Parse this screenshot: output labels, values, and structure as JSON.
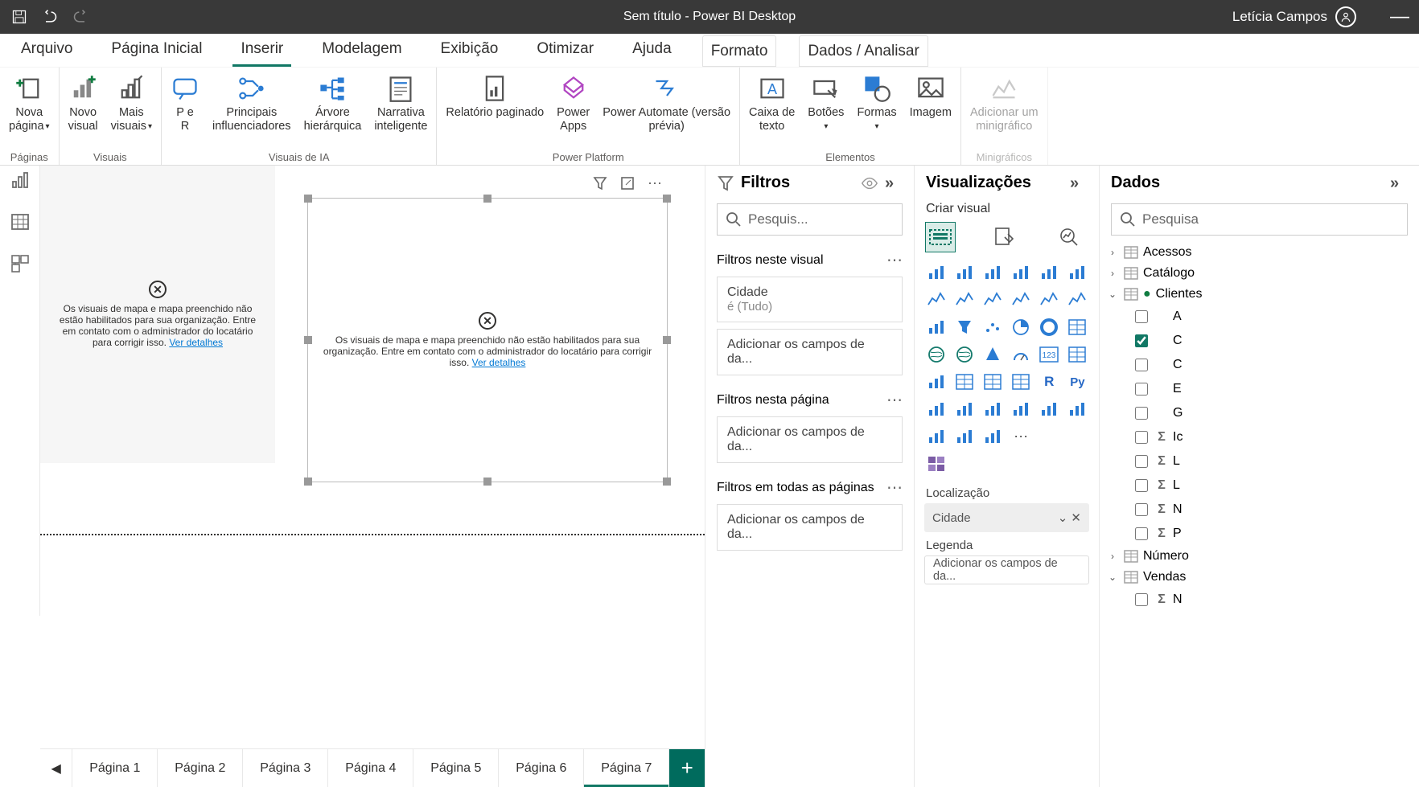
{
  "titlebar": {
    "title": "Sem título - Power BI Desktop",
    "user": "Letícia Campos"
  },
  "tabs": [
    "Arquivo",
    "Página Inicial",
    "Inserir",
    "Modelagem",
    "Exibição",
    "Otimizar",
    "Ajuda",
    "Formato",
    "Dados / Analisar"
  ],
  "active_tab_index": 2,
  "ribbon": {
    "groups": [
      {
        "label": "Páginas",
        "buttons": [
          {
            "l1": "Nova",
            "l2": "página",
            "dd": true
          }
        ]
      },
      {
        "label": "Visuais",
        "buttons": [
          {
            "l1": "Novo",
            "l2": "visual"
          },
          {
            "l1": "Mais",
            "l2": "visuais",
            "dd": true
          }
        ]
      },
      {
        "label": "Visuais de IA",
        "buttons": [
          {
            "l1": "P e",
            "l2": "R"
          },
          {
            "l1": "Principais",
            "l2": "influenciadores"
          },
          {
            "l1": "Árvore",
            "l2": "hierárquica"
          },
          {
            "l1": "Narrativa",
            "l2": "inteligente"
          }
        ]
      },
      {
        "label": "Power Platform",
        "buttons": [
          {
            "l1": "Relatório paginado",
            "l2": ""
          },
          {
            "l1": "Power",
            "l2": "Apps"
          },
          {
            "l1": "Power Automate (versão",
            "l2": "prévia)"
          }
        ]
      },
      {
        "label": "Elementos",
        "buttons": [
          {
            "l1": "Caixa de",
            "l2": "texto"
          },
          {
            "l1": "Botões",
            "l2": "",
            "dd": true
          },
          {
            "l1": "Formas",
            "l2": "",
            "dd": true
          },
          {
            "l1": "Imagem",
            "l2": ""
          }
        ]
      },
      {
        "label": "Minigráficos",
        "disabled": true,
        "buttons": [
          {
            "l1": "Adicionar um",
            "l2": "minigráfico"
          }
        ]
      }
    ]
  },
  "visual_error": {
    "msg": "Os visuais de mapa e mapa preenchido não estão habilitados para sua organização. Entre em contato com o administrador do locatário para corrigir isso.",
    "link": "Ver detalhes"
  },
  "pages": [
    "Página 1",
    "Página 2",
    "Página 3",
    "Página 4",
    "Página 5",
    "Página 6",
    "Página 7"
  ],
  "active_page_index": 6,
  "filters": {
    "title": "Filtros",
    "search_placeholder": "Pesquis...",
    "sec_visual": "Filtros neste visual",
    "visual_filter": {
      "field": "Cidade",
      "value": "é (Tudo)"
    },
    "add_fields": "Adicionar os campos de da...",
    "sec_page": "Filtros nesta página",
    "sec_all": "Filtros em todas as páginas"
  },
  "viz": {
    "title": "Visualizações",
    "subtitle": "Criar visual",
    "loc_label": "Localização",
    "loc_value": "Cidade",
    "legend_label": "Legenda",
    "legend_placeholder": "Adicionar os campos de da..."
  },
  "data": {
    "title": "Dados",
    "search_placeholder": "Pesquisa",
    "tables": [
      {
        "name": "Acessos",
        "expanded": false
      },
      {
        "name": "Catálogo",
        "expanded": false
      },
      {
        "name": "Clientes",
        "expanded": true,
        "checkmark": true,
        "fields": [
          "A",
          "C",
          "C",
          "E",
          "G",
          "Ic",
          "L",
          "L",
          "N",
          "P"
        ],
        "checked_index": 1,
        "sigma_start": 5
      },
      {
        "name": "Número",
        "expanded": false
      },
      {
        "name": "Vendas",
        "expanded": true,
        "fields": [
          "N"
        ],
        "sigma_start": 0
      }
    ]
  }
}
